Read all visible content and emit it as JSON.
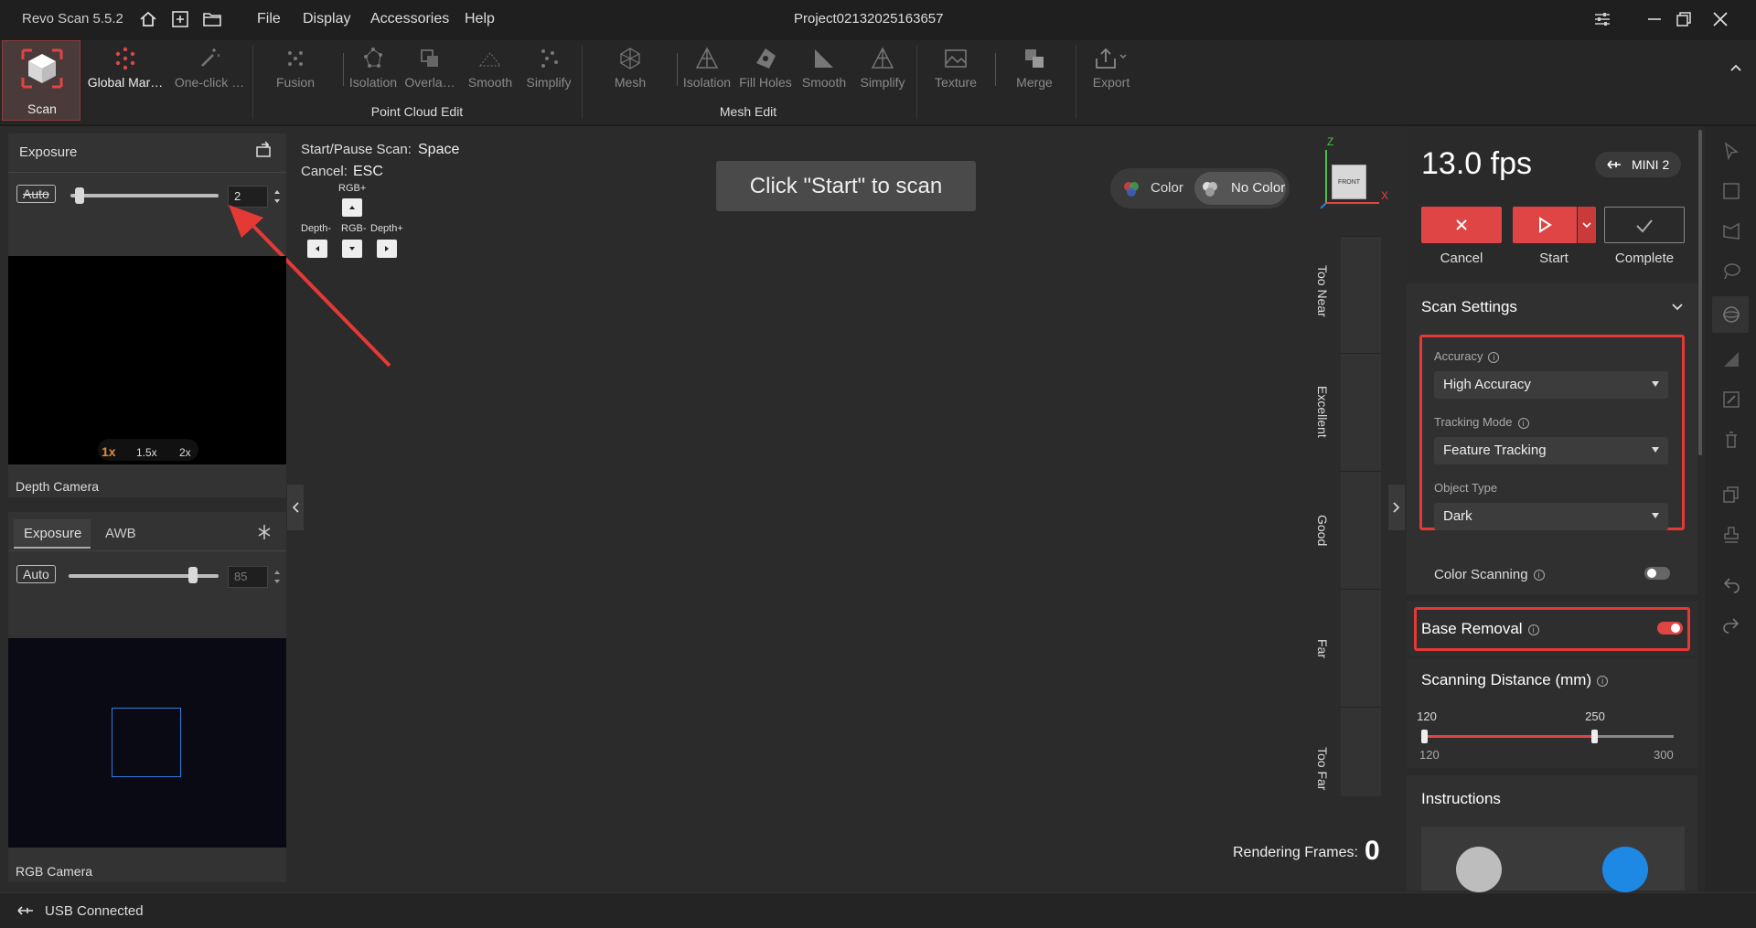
{
  "app": {
    "title": "Revo Scan 5.5.2",
    "project": "Project02132025163657",
    "menu": [
      "File",
      "Display",
      "Accessories",
      "Help"
    ]
  },
  "toolbar": {
    "scan": "Scan",
    "global_markers": "Global Mar…",
    "one_click": "One-click …",
    "point_cloud": {
      "fusion": "Fusion",
      "isolation": "Isolation",
      "overlap": "Overla…",
      "smooth": "Smooth",
      "simplify": "Simplify",
      "group": "Point Cloud Edit"
    },
    "mesh": {
      "mesh": "Mesh",
      "isolation": "Isolation",
      "fill_holes": "Fill Holes",
      "smooth": "Smooth",
      "simplify": "Simplify",
      "group": "Mesh Edit"
    },
    "texture": "Texture",
    "merge": "Merge",
    "export": "Export"
  },
  "depth_panel": {
    "title": "Exposure",
    "auto": "Auto",
    "value": "2",
    "zoom": [
      "1x",
      "1.5x",
      "2x"
    ],
    "camera_label": "Depth Camera"
  },
  "rgb_panel": {
    "tabs": [
      "Exposure",
      "AWB"
    ],
    "auto": "Auto",
    "value": "85",
    "camera_label": "RGB Camera"
  },
  "hints": {
    "start_pause_label": "Start/Pause Scan:",
    "start_pause_key": "Space",
    "cancel_label": "Cancel:",
    "cancel_key": "ESC",
    "rgb_plus": "RGB+",
    "depth_minus": "Depth-",
    "rgb_minus": "RGB-",
    "depth_plus": "Depth+"
  },
  "center": {
    "prompt": "Click \"Start\" to scan",
    "color": "Color",
    "no_color": "No Color",
    "axis_z": "Z",
    "axis_x": "X",
    "front": "FRONT",
    "rendering_label": "Rendering Frames:",
    "rendering_value": "0"
  },
  "quality": [
    "Too Near",
    "Excellent",
    "Good",
    "Far",
    "Too Far"
  ],
  "right_panel": {
    "fps": "13.0 fps",
    "device": "MINI 2",
    "cancel": "Cancel",
    "start": "Start",
    "complete": "Complete",
    "scan_settings": "Scan Settings",
    "accuracy_label": "Accuracy",
    "accuracy_value": "High Accuracy",
    "tracking_label": "Tracking Mode",
    "tracking_value": "Feature Tracking",
    "object_label": "Object Type",
    "object_value": "Dark",
    "color_scanning": "Color Scanning",
    "color_scanning_on": false,
    "base_removal": "Base Removal",
    "base_removal_on": true,
    "distance_title": "Scanning Distance (mm)",
    "distance_low": "120",
    "distance_high": "250",
    "distance_min": "120",
    "distance_max": "300",
    "instructions": "Instructions"
  },
  "status": {
    "usb": "USB Connected"
  },
  "colors": {
    "accent_red": "#e04545",
    "highlight_red": "#e53935",
    "selection_blue": "#2f7ee0"
  }
}
